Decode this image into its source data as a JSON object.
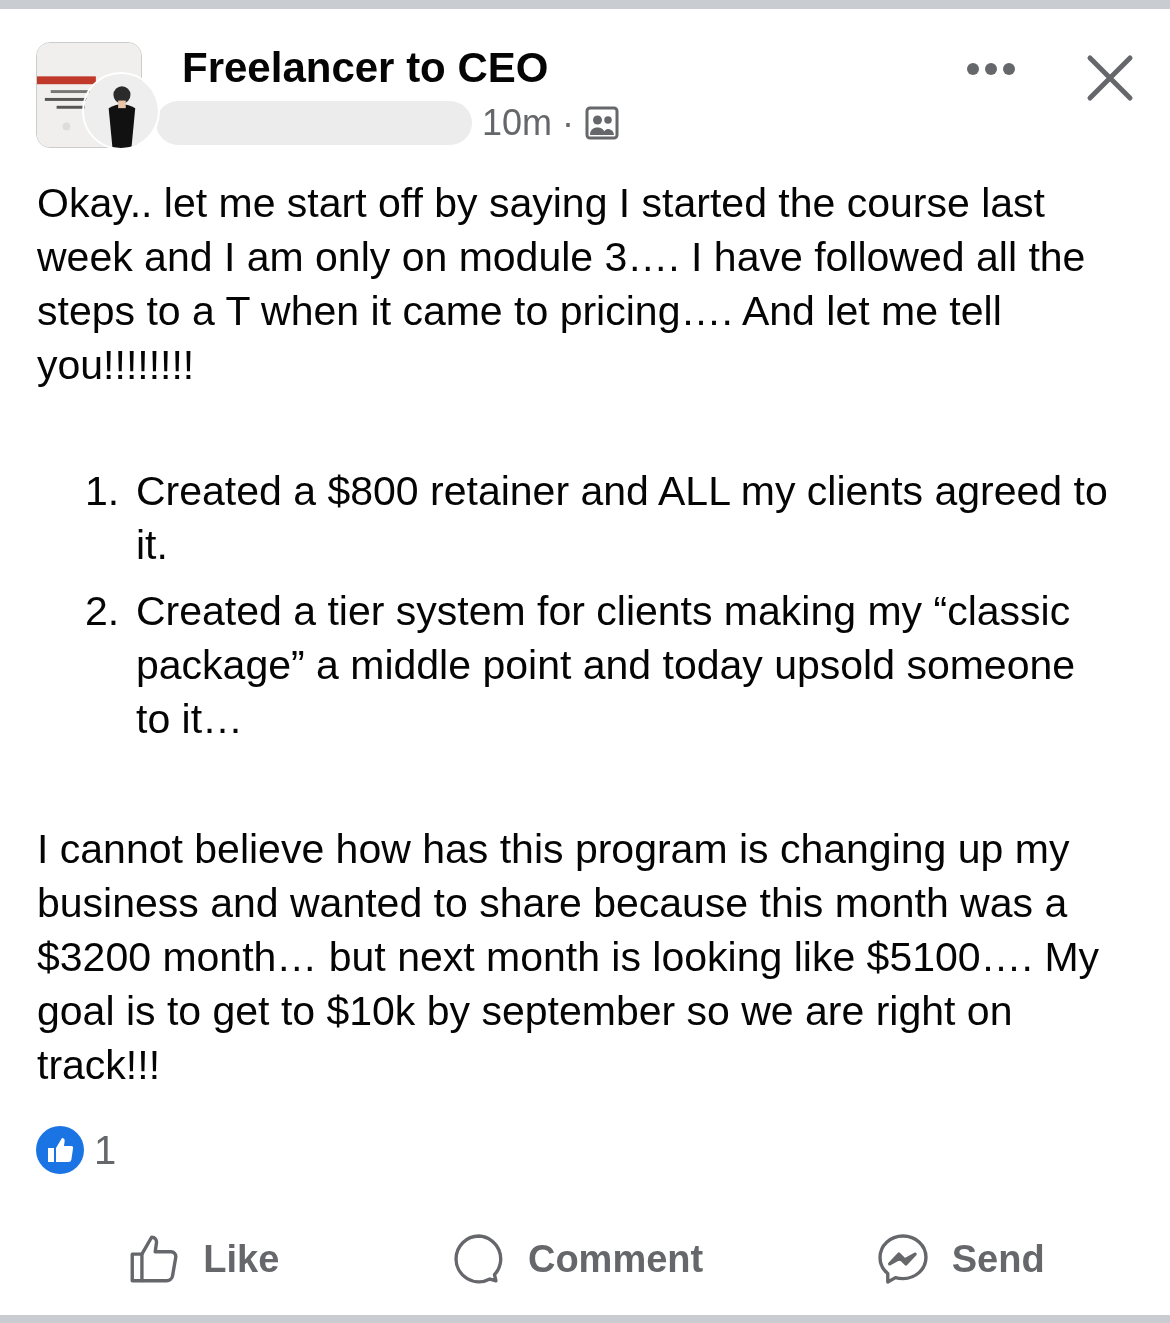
{
  "post": {
    "group_name": "Freelancer to CEO",
    "time": "10m",
    "separator": "·",
    "paragraphs": [
      {
        "kind": "text",
        "text": "Okay.. let me start off by saying I started the course last week and I am only on module 3…. I have followed all the steps to a T when it came to pricing…. And let me tell you!!!!!!!!"
      },
      {
        "kind": "list",
        "items": [
          {
            "number": "1.",
            "text": "Created a $800 retainer and ALL my clients agreed to it."
          },
          {
            "number": "2.",
            "text": "Created a tier system for clients making my “classic package” a middle point and today upsold someone to it…"
          }
        ]
      },
      {
        "kind": "text",
        "text": "I cannot believe how has this program is changing up my business and wanted to share because this month was a $3200 month… but next month is looking like $5100…. My goal is to get to $10k by september so we are right on track!!!"
      }
    ],
    "reaction_count": "1",
    "actions": [
      {
        "kind": "like",
        "label": "Like"
      },
      {
        "kind": "comment",
        "label": "Comment"
      },
      {
        "kind": "send",
        "label": "Send"
      }
    ]
  }
}
